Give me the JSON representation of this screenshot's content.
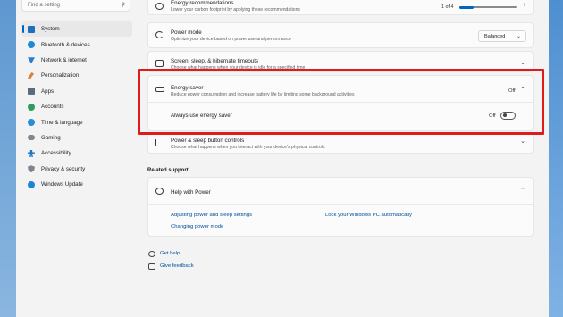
{
  "search": {
    "placeholder": "Find a setting"
  },
  "sidebar": {
    "items": [
      {
        "label": "System",
        "icon": "system-icon",
        "active": true
      },
      {
        "label": "Bluetooth & devices",
        "icon": "bluetooth-icon"
      },
      {
        "label": "Network & internet",
        "icon": "network-icon"
      },
      {
        "label": "Personalization",
        "icon": "brush-icon"
      },
      {
        "label": "Apps",
        "icon": "apps-icon"
      },
      {
        "label": "Accounts",
        "icon": "accounts-icon"
      },
      {
        "label": "Time & language",
        "icon": "globe-clock-icon"
      },
      {
        "label": "Gaming",
        "icon": "gamepad-icon"
      },
      {
        "label": "Accessibility",
        "icon": "accessibility-icon"
      },
      {
        "label": "Privacy & security",
        "icon": "shield-icon"
      },
      {
        "label": "Windows Update",
        "icon": "update-icon"
      }
    ]
  },
  "energy_recommendations": {
    "title": "Energy recommendations",
    "subtitle": "Lower your carbon footprint by applying these recommendations",
    "progress_text": "1 of 4",
    "progress_fraction": 0.25
  },
  "power_mode": {
    "title": "Power mode",
    "subtitle": "Optimize your device based on power use and performance",
    "value": "Balanced"
  },
  "screen_sleep": {
    "title": "Screen, sleep, & hibernate timeouts",
    "subtitle": "Choose what happens when your device is idle for a specified time"
  },
  "energy_saver": {
    "title": "Energy saver",
    "subtitle": "Reduce power consumption and increase battery life by limiting some background activities",
    "status": "Off",
    "always_use_label": "Always use energy saver",
    "toggle_state": "Off"
  },
  "power_buttons": {
    "title": "Power & sleep button controls",
    "subtitle": "Choose what happens when you interact with your device's physical controls"
  },
  "related_support": {
    "heading": "Related support",
    "help_title": "Help with Power",
    "links": [
      "Adjusting power and sleep settings",
      "Lock your Windows PC automatically",
      "Changing power mode"
    ]
  },
  "footer": {
    "get_help": "Get help",
    "give_feedback": "Give feedback"
  },
  "colors": {
    "accent": "#0067c0",
    "highlight": "#e01b1b"
  }
}
